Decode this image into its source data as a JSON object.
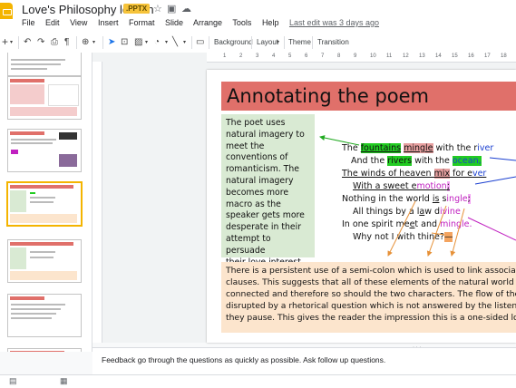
{
  "app": {
    "doc_title": "Love's Philosophy lesson",
    "file_badge": ".PPTX",
    "menu": [
      "File",
      "Edit",
      "View",
      "Insert",
      "Format",
      "Slide",
      "Arrange",
      "Tools",
      "Help"
    ],
    "last_edit": "Last edit was 3 days ago"
  },
  "toolbar": {
    "background_label": "Background",
    "layout_label": "Layout",
    "theme_label": "Theme",
    "transition_label": "Transition"
  },
  "ruler": {
    "ticks": [
      "1",
      "2",
      "3",
      "4",
      "5",
      "6",
      "7",
      "8",
      "9",
      "10",
      "11",
      "12",
      "13",
      "14",
      "15",
      "16",
      "17",
      "18"
    ]
  },
  "filmstrip": {
    "numbers": [
      "",
      "",
      "",
      "",
      "",
      ""
    ],
    "selected_index": 3
  },
  "slide": {
    "title": "Annotating the poem",
    "side_note_lines": [
      "The poet uses",
      "natural imagery to",
      "meet the",
      "conventions of",
      "romanticism. The",
      "natural imagery",
      "becomes more",
      "macro as the",
      "speaker gets more",
      "desperate in their",
      "attempt to persuade",
      "their love interest."
    ],
    "poem": {
      "l1_a": "The ",
      "l1_b": "fountains",
      "l1_c": " ",
      "l1_d": "mingle",
      "l1_e": " with the r",
      "l1_f": "iver",
      "l2_a": "And the ",
      "l2_b": "rivers",
      "l2_c": " with the ",
      "l2_d": "ocean,",
      "l3_a": "The winds of heaven ",
      "l3_b": "mix",
      "l3_c": " for e",
      "l3_d": "ver",
      "l4_a": "With a sweet e",
      "l4_b": "motion",
      "l4_c": ";",
      "l5_a": "Nothing in the world ",
      "l5_b": "is",
      "l5_c": " s",
      "l5_d": "ingle",
      "l5_e": ";",
      "l6_a": "All things by a l",
      "l6_b": "a",
      "l6_c": "w d",
      "l6_d": "ivine",
      "l7_a": "In one spirit me",
      "l7_b": "e",
      "l7_c": "t and ",
      "l7_d": "mingle.",
      "l8_a": "Why not I with thine?",
      "l8_b": "—"
    },
    "analysis_lines": [
      "There is a persistent use of a semi-colon which is used to link associated",
      "clauses. This suggests that all of these elements of the natural world are",
      "connected and therefore so should the two characters. The flow of the po",
      "disrupted by a rhetorical question which is not answered by the listener o",
      "they pause. This gives the reader the impression this is a one-sided love."
    ]
  },
  "notes": {
    "text": "Feedback go through the questions as quickly as possible. Ask follow up questions."
  },
  "colors": {
    "title_banner": "#e0706a",
    "side_box": "#d9ead3",
    "analysis_box": "#fce5cd",
    "highlight_green": "#22cc22",
    "highlight_pink": "#e7a0a0",
    "selected_thumb": "#f4b400",
    "brand": "#f4b400"
  }
}
